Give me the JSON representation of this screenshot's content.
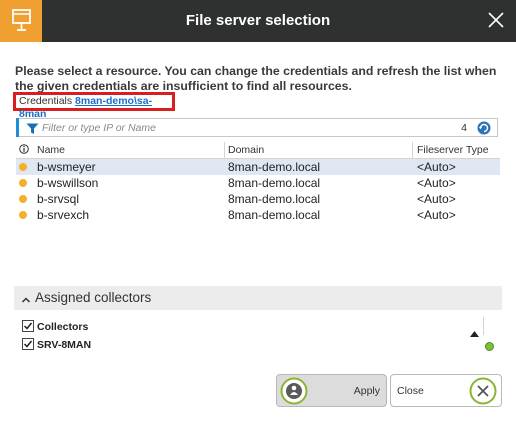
{
  "window": {
    "title": "File server selection"
  },
  "instructions": "Please select a resource. You can change the credentials and refresh the list when the given credentials are insufficient to find all resources.",
  "credentials": {
    "label": "Credentials",
    "value": "8man-demo\\sa-8man"
  },
  "filter": {
    "placeholder": "Filter or type IP or Name",
    "count": "4"
  },
  "table": {
    "columns": [
      "Name",
      "Domain",
      "Fileserver Type"
    ],
    "rows": [
      {
        "name": "b-wsmeyer",
        "domain": "8man-demo.local",
        "type": "<Auto>"
      },
      {
        "name": "b-wswillson",
        "domain": "8man-demo.local",
        "type": "<Auto>"
      },
      {
        "name": "b-srvsql",
        "domain": "8man-demo.local",
        "type": "<Auto>"
      },
      {
        "name": "b-srvexch",
        "domain": "8man-demo.local",
        "type": "<Auto>"
      }
    ]
  },
  "assigned": {
    "section_label": "Assigned collectors",
    "header": "Collectors",
    "items": [
      {
        "name": "SRV-8MAN"
      }
    ]
  },
  "buttons": {
    "apply": "Apply",
    "close": "Close"
  },
  "colors": {
    "accent": "#f0a030",
    "titlebar": "#2f3030",
    "highlight": "#d81e1e",
    "link": "#1a6ec8",
    "status_ok": "#7cc13a"
  }
}
